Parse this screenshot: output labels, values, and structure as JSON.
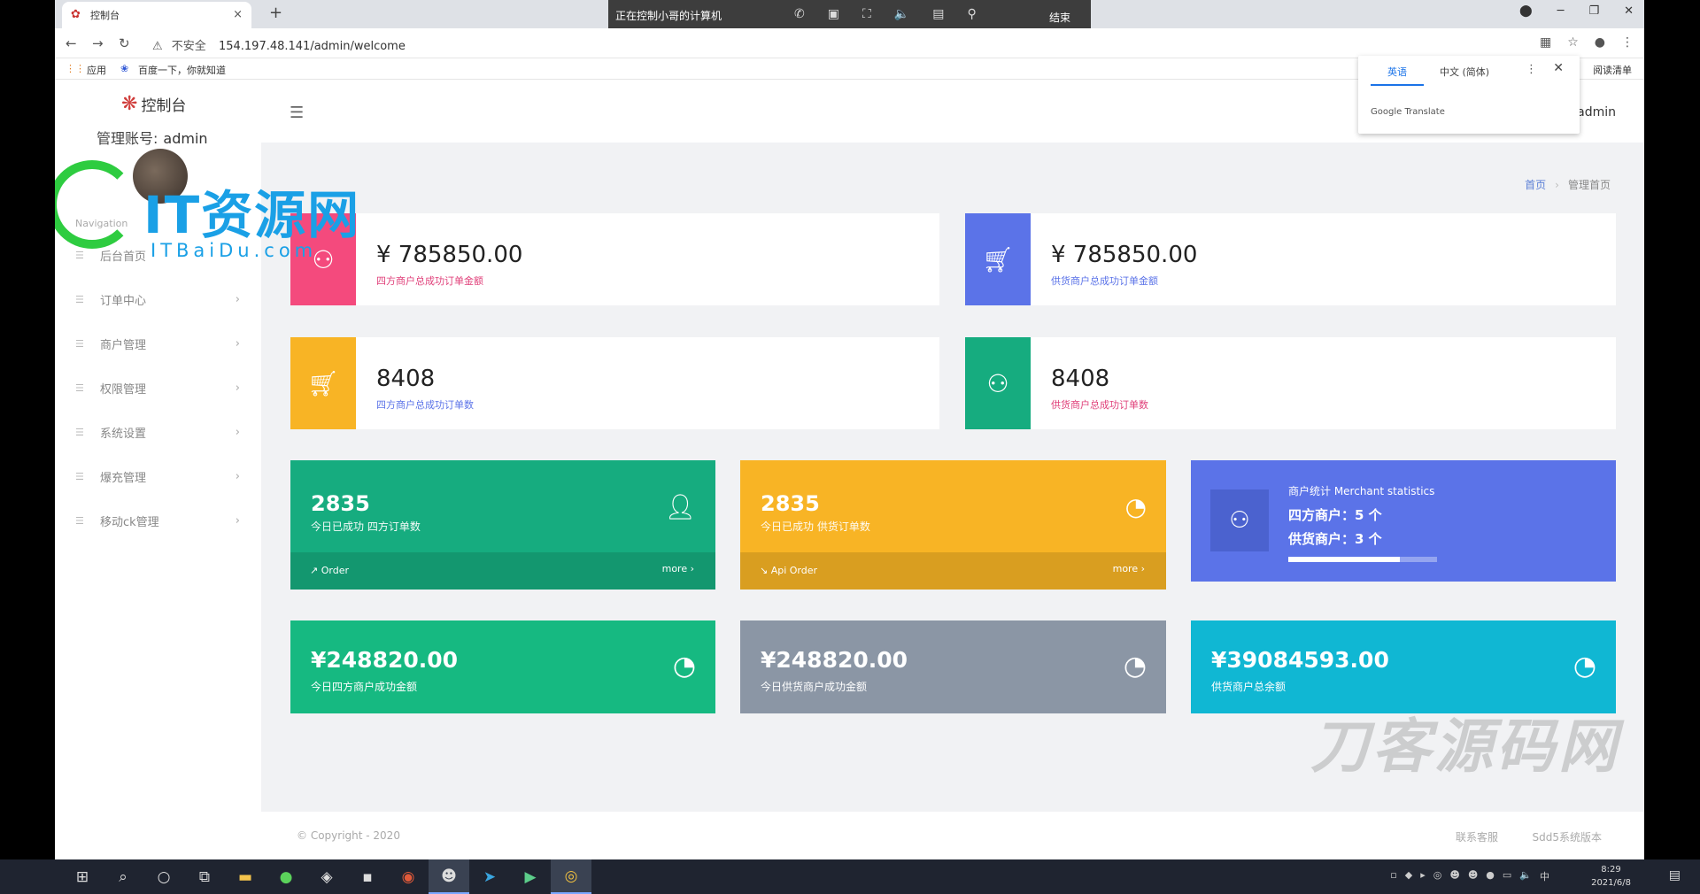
{
  "browser": {
    "tab_title": "控制台",
    "tab_close": "×",
    "new_tab": "+",
    "url_insecure": "不安全",
    "url": "154.197.48.141/admin/welcome",
    "bookmarks": [
      "应用",
      "百度一下，你就知道"
    ],
    "reading_list": "阅读清单",
    "remote_title": "正在控制小哥的计算机",
    "remote_end": "结束"
  },
  "translate_popup": {
    "tab_english": "英语",
    "tab_chinese": "中文 (简体)",
    "brand": "Google Translate"
  },
  "sidebar": {
    "logo": "控制台",
    "account_label": "管理账号:",
    "account_name": "admin",
    "nav_label": "Navigation",
    "items": [
      {
        "label": "后台首页"
      },
      {
        "label": "订单中心"
      },
      {
        "label": "商户管理"
      },
      {
        "label": "权限管理"
      },
      {
        "label": "系统设置"
      },
      {
        "label": "爆充管理"
      },
      {
        "label": "移动ck管理"
      }
    ]
  },
  "watermark": {
    "title": "IT资源网",
    "sub": "ITBaiDu.com",
    "bottom": "刀客源码网"
  },
  "header": {
    "user": "admin"
  },
  "breadcrumb": {
    "home": "首页",
    "current": "管理首页"
  },
  "stats": [
    {
      "value": "¥ 785850.00",
      "label": "四方商户总成功订单金额",
      "color": "#f44a7d",
      "label_color": "#e0407a",
      "icon": "users-icon"
    },
    {
      "value": "¥ 785850.00",
      "label": "供货商户总成功订单金额",
      "color": "#5b73e8",
      "label_color": "#5b73e8",
      "icon": "cart-icon"
    },
    {
      "value": "8408",
      "label": "四方商户总成功订单数",
      "color": "#f8b425",
      "label_color": "#5b73e8",
      "icon": "cart-icon"
    },
    {
      "value": "8408",
      "label": "供货商户总成功订单数",
      "color": "#16ac7f",
      "label_color": "#e0407a",
      "icon": "users-icon"
    }
  ],
  "tiles": [
    {
      "value": "2835",
      "label": "今日已成功 四方订单数",
      "foot_left": "Order",
      "foot_right": "more ›",
      "color": "#16ac7f"
    },
    {
      "value": "2835",
      "label": "今日已成功 供货订单数",
      "foot_left": "Api Order",
      "foot_right": "more ›",
      "color": "#f8b425"
    }
  ],
  "merchant_stats": {
    "title": "商户统计 Merchant statistics",
    "line1": "四方商户：5 个",
    "line2": "供货商户：3 个",
    "progress": 0.75,
    "color": "#5b73e8"
  },
  "money": [
    {
      "value": "¥248820.00",
      "label": "今日四方商户成功金额",
      "color": "#16b981"
    },
    {
      "value": "¥248820.00",
      "label": "今日供货商户成功金额",
      "color": "#8b96a5"
    },
    {
      "value": "¥39084593.00",
      "label": "供货商户总余额",
      "color": "#10b7d3"
    }
  ],
  "footer": {
    "copyright": "© Copyright - 2020",
    "link1": "联系客服",
    "link2": "Sdd5系统版本"
  },
  "taskbar": {
    "time": "8:29",
    "date": "2021/6/8",
    "ime": "中"
  }
}
